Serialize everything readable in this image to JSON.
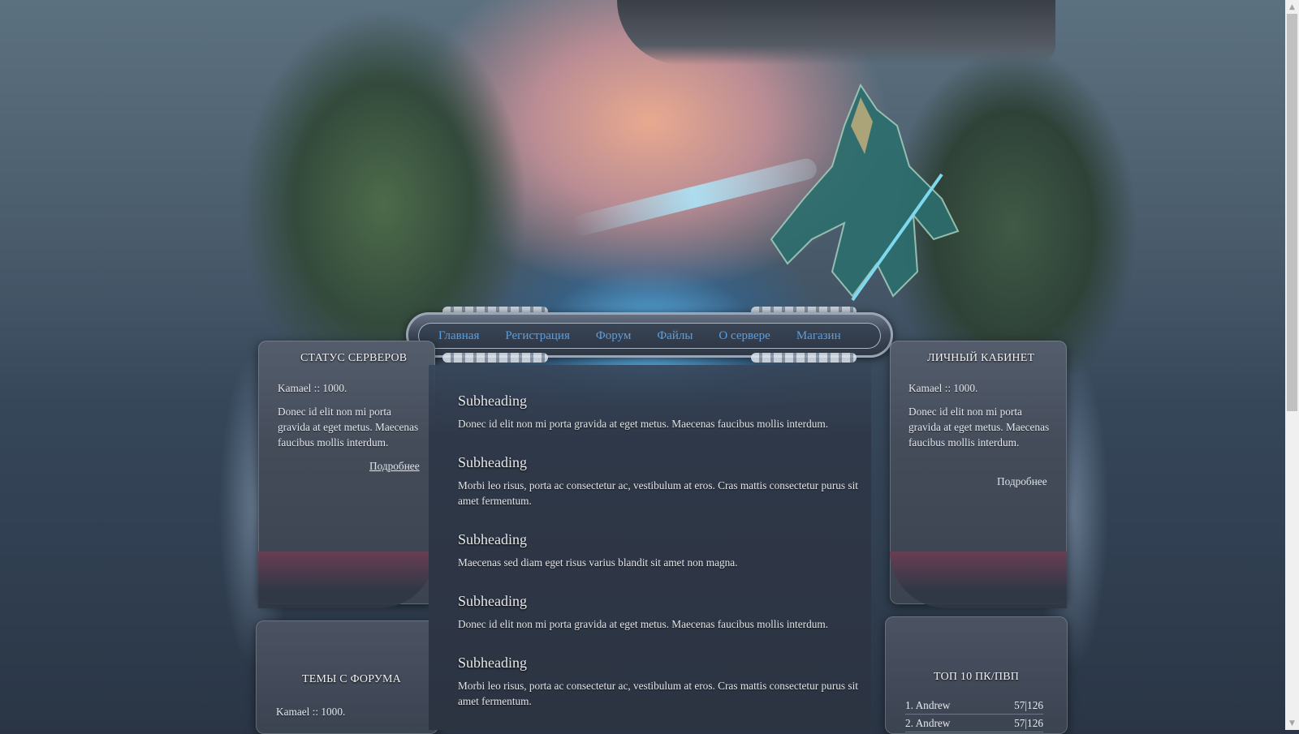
{
  "nav": {
    "items": [
      {
        "label": "Главная"
      },
      {
        "label": "Регистрация"
      },
      {
        "label": "Форум"
      },
      {
        "label": "Файлы"
      },
      {
        "label": "О сервере"
      },
      {
        "label": "Магазин"
      }
    ]
  },
  "left_panel": {
    "title": "СТАТУС СЕРВЕРОВ",
    "server_line": "Kamael :: 1000.",
    "text": "Donec id elit non mi porta gravida at eget metus. Maecenas faucibus mollis interdum.",
    "more": "Подробнее"
  },
  "left_lower_panel": {
    "title": "ТЕМЫ С ФОРУМА",
    "line": "Kamael :: 1000."
  },
  "right_panel": {
    "title": "ЛИЧНЫЙ КАБИНЕТ",
    "server_line": "Kamael :: 1000.",
    "text": "Donec id elit non mi porta gravida at eget metus. Maecenas faucibus mollis interdum.",
    "more": "Подробнее"
  },
  "right_lower_panel": {
    "title": "ТОП 10 ПК/ПВП",
    "rows": [
      {
        "name": "1. Andrew",
        "score": "57|126"
      },
      {
        "name": "2. Andrew",
        "score": "57|126"
      }
    ]
  },
  "articles": [
    {
      "heading": "Subheading",
      "text": "Donec id elit non mi porta gravida at eget metus. Maecenas faucibus mollis interdum."
    },
    {
      "heading": "Subheading",
      "text": "Morbi leo risus, porta ac consectetur ac, vestibulum at eros. Cras mattis consectetur purus sit amet fermentum."
    },
    {
      "heading": "Subheading",
      "text": "Maecenas sed diam eget risus varius blandit sit amet non magna."
    },
    {
      "heading": "Subheading",
      "text": "Donec id elit non mi porta gravida at eget metus. Maecenas faucibus mollis interdum."
    },
    {
      "heading": "Subheading",
      "text": "Morbi leo risus, porta ac consectetur ac, vestibulum at eros. Cras mattis consectetur purus sit amet fermentum."
    }
  ],
  "colors": {
    "nav_link": "#5a9fe0",
    "panel_bg": "#4a5262",
    "content_bg": "#2f3848"
  },
  "icons": {
    "scroll_up": "triangle-up-icon",
    "scroll_down": "triangle-down-icon"
  }
}
